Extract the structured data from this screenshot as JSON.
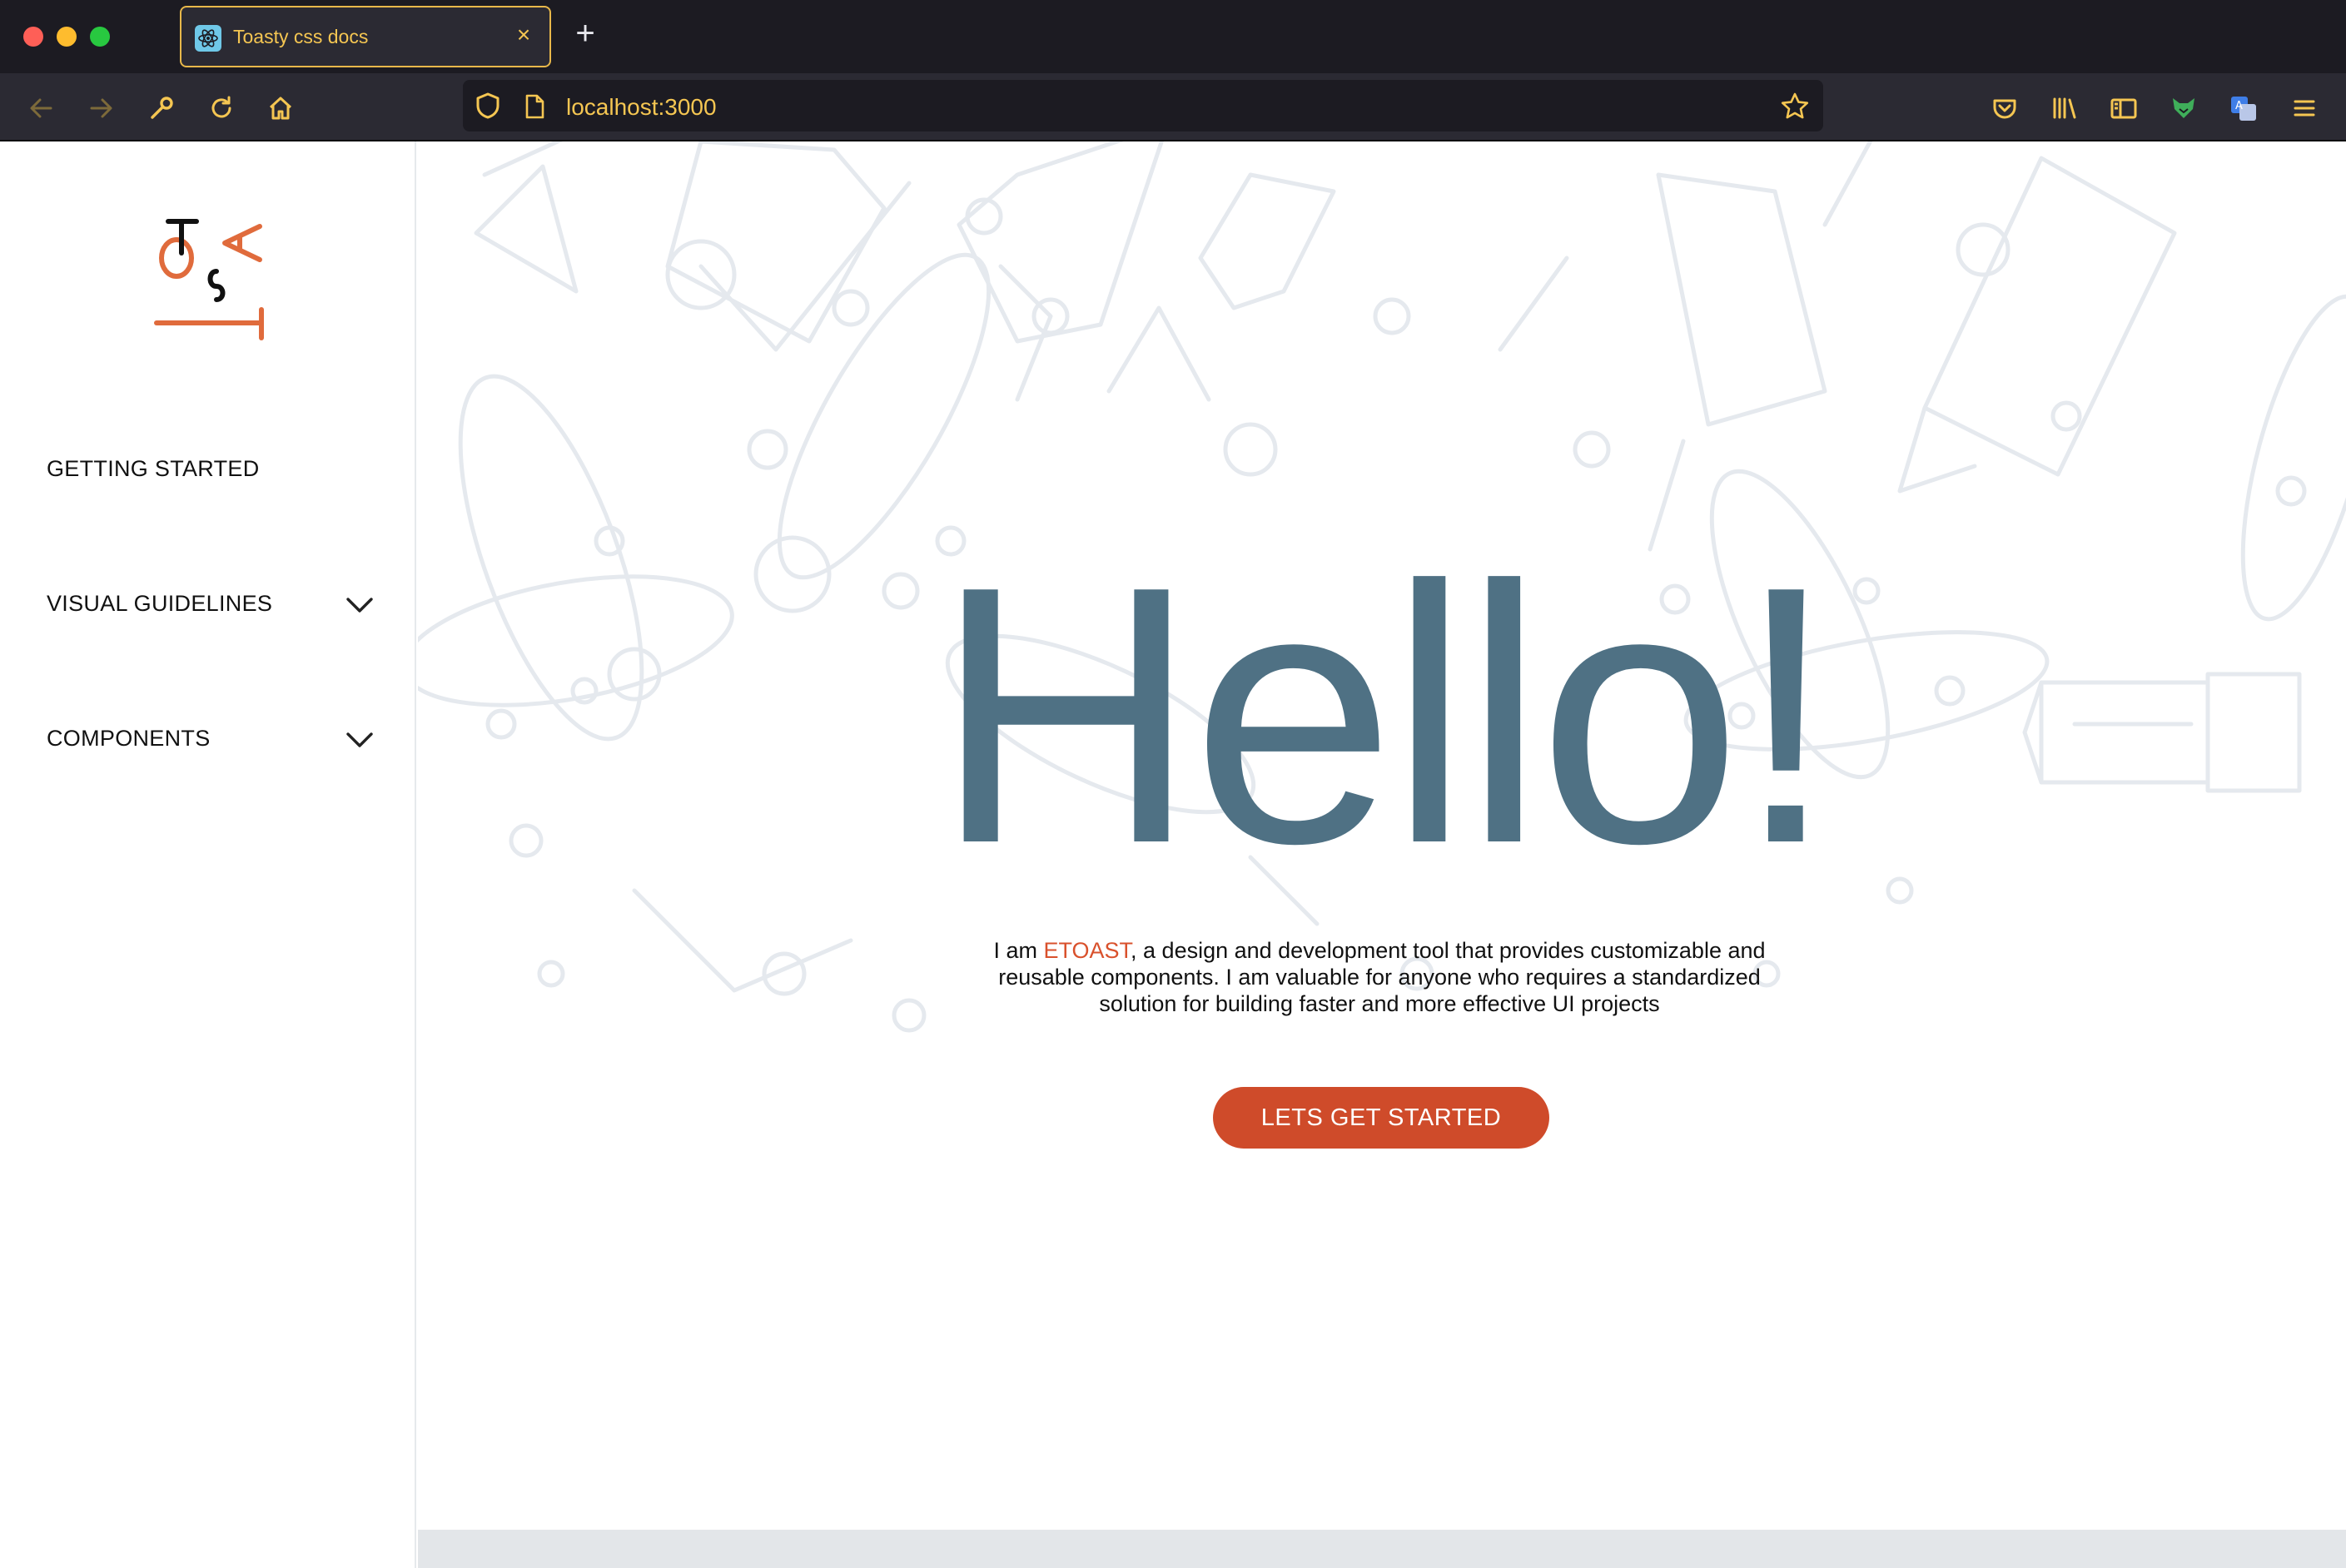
{
  "browser": {
    "tab_title": "Toasty css docs",
    "tab_close": "×",
    "new_tab": "+",
    "url": "localhost:3000"
  },
  "sidebar": {
    "logo_letters": [
      "T",
      "O",
      "A",
      "S",
      "T"
    ],
    "items": [
      {
        "label": "GETTING STARTED",
        "expandable": false
      },
      {
        "label": "VISUAL GUIDELINES",
        "expandable": true
      },
      {
        "label": "COMPONENTS",
        "expandable": true
      }
    ]
  },
  "hero": {
    "heading": "Hello!",
    "intro_prefix": "I am ",
    "brand": "ETOAST",
    "intro_suffix": ", a design and development tool that provides customizable and reusable components. I am valuable for anyone who requires a standardized solution for building faster and more effective UI projects",
    "cta_label": "LETS GET STARTED"
  },
  "colors": {
    "brand_orange": "#cf4b2a",
    "heading_blue": "#4f7184",
    "accent_yellow": "#f5c652"
  }
}
